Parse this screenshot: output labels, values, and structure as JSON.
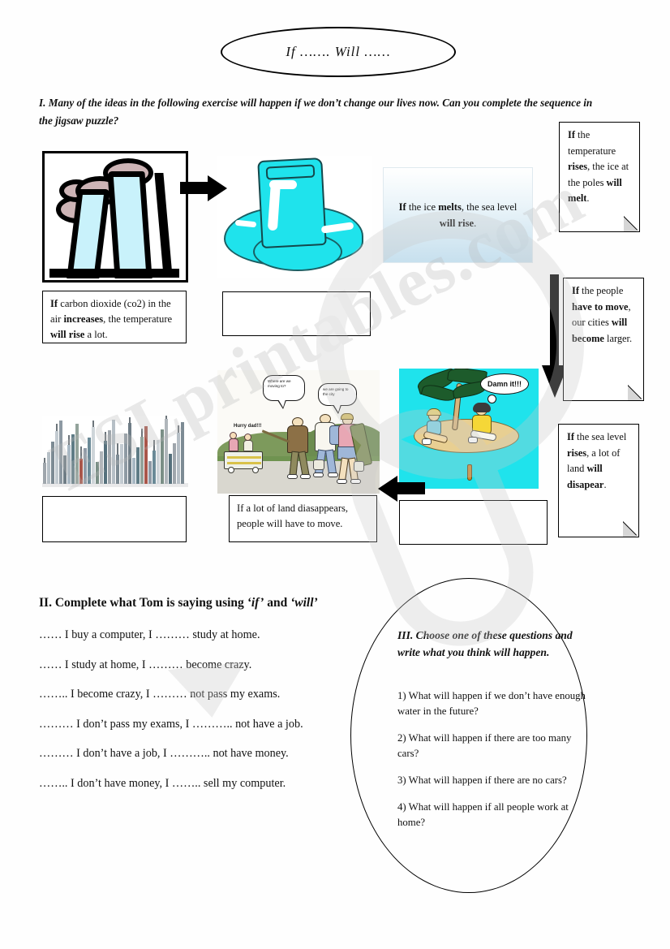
{
  "title": {
    "text": "If ……. Will ……"
  },
  "section1": {
    "instruction": "I. Many of the ideas in the following exercise will happen if we don’t change our lives now. Can you complete the sequence in the jigsaw puzzle?",
    "caption_co2_html": "<b>If</b> carbon dioxide (co2) in the air <b>increases</b>, the temperature <b>will rise</b> a lot.",
    "blue_box_html": "<b>If</b> the ice <b>melts</b>, the sea level <b>will rise</b>.",
    "caption_land": "If a lot of land diasappears, people will have to move.",
    "answer_box_1": "",
    "answer_box_2": "",
    "answer_box_3": "",
    "notes": [
      {
        "html": "<b>If</b> the temperature <b>rises</b>, the ice at the poles <b>will melt</b>."
      },
      {
        "html": "<b>If</b> the people <b>have to move</b>, our cities <b>will become</b> larger."
      },
      {
        "html": "<b>If</b> the sea level <b>rises</b>, a lot of land <b>will disapear</b>."
      }
    ],
    "images": {
      "factory": "factory-smokestacks-illustration",
      "ice": "melting-ice-cube-illustration",
      "city": "city-skyline-photo",
      "hike": "family-migrating-cartoon",
      "island": "people-on-small-island-cartoon"
    },
    "cartoon_text": {
      "hike_bubble_1": "Where are we moving to?",
      "hike_bubble_2": "we are going to the city",
      "hike_shout": "Hurry dad!!!",
      "island_bubble": "Damn it!!!"
    }
  },
  "section2": {
    "heading_html": "II. Complete what Tom is saying using <i>‘if’</i> and <i>‘will’</i>",
    "items": [
      "…… I buy a computer, I ……… study at home.",
      "…… I study at home, I ……… become crazy.",
      "…….. I become crazy, I ……… not pass my exams.",
      "……… I don’t pass my exams, I ……….. not have a job.",
      "……… I don’t have a job, I ……….. not have money.",
      "…….. I don’t have money, I …….. sell my computer."
    ]
  },
  "section3": {
    "heading": "III. Choose one of these questions and write what you think will happen.",
    "questions": [
      "1) What will happen if we don’t have enough water in the future?",
      "2) What will happen if there are too many cars?",
      "3) What will happen if there are no cars?",
      "4) What will happen if all people work at home?"
    ]
  },
  "watermark": {
    "text": "ESLprintables.com"
  },
  "colors": {
    "ice_cyan": "#1fe3ec",
    "smoke_mauve": "#cdb4b6",
    "chimney_blue": "#c9f2fb",
    "sand": "#e8cf92",
    "palm_green": "#1d5b2b",
    "blue_box_bottom": "#c7e0ee"
  }
}
